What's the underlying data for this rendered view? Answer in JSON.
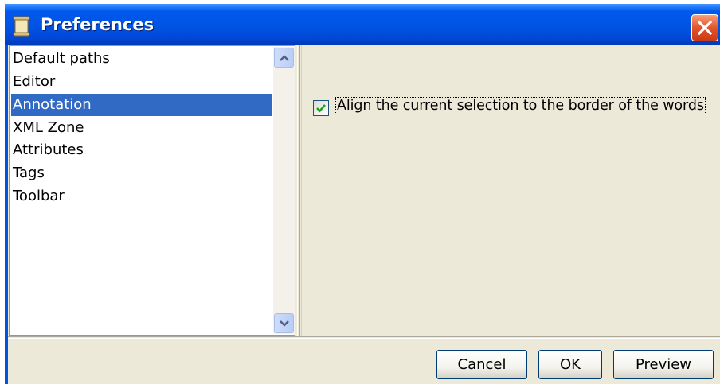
{
  "window": {
    "title": "Preferences",
    "title_icon": "scroll-icon",
    "close_icon": "close-icon"
  },
  "categories": [
    {
      "label": "Default paths",
      "selected": false
    },
    {
      "label": "Editor",
      "selected": false
    },
    {
      "label": "Annotation",
      "selected": true
    },
    {
      "label": "XML Zone",
      "selected": false
    },
    {
      "label": "Attributes",
      "selected": false
    },
    {
      "label": "Tags",
      "selected": false
    },
    {
      "label": "Toolbar",
      "selected": false
    }
  ],
  "scrollbar": {
    "up_icon": "chevron-up-icon",
    "down_icon": "chevron-down-icon"
  },
  "annotation": {
    "align_label": "Align the current selection to the border of the words",
    "align_checked": true
  },
  "buttons": {
    "cancel": "Cancel",
    "ok": "OK",
    "preview": "Preview"
  },
  "colors": {
    "titlebar": "#0054e3",
    "selection": "#316ac5",
    "dialog_bg": "#ece9d8",
    "close_button": "#e2542c"
  }
}
